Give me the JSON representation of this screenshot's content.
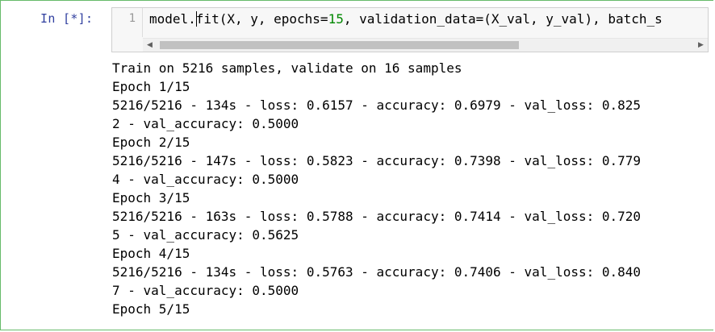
{
  "cell": {
    "prompt": "In [*]:",
    "line_number": "1",
    "code": {
      "before_cursor": "model.",
      "after_cursor_1": "fit(X, y, epochs=",
      "epochs_value": "15",
      "after_cursor_2": ", validation_data=(X_val, y_val), batch_s"
    }
  },
  "output": {
    "lines": [
      "Train on 5216 samples, validate on 16 samples",
      "Epoch 1/15",
      "5216/5216 - 134s - loss: 0.6157 - accuracy: 0.6979 - val_loss: 0.825",
      "2 - val_accuracy: 0.5000",
      "Epoch 2/15",
      "5216/5216 - 147s - loss: 0.5823 - accuracy: 0.7398 - val_loss: 0.779",
      "4 - val_accuracy: 0.5000",
      "Epoch 3/15",
      "5216/5216 - 163s - loss: 0.5788 - accuracy: 0.7414 - val_loss: 0.720",
      "5 - val_accuracy: 0.5625",
      "Epoch 4/15",
      "5216/5216 - 134s - loss: 0.5763 - accuracy: 0.7406 - val_loss: 0.840",
      "7 - val_accuracy: 0.5000",
      "Epoch 5/15"
    ]
  },
  "icons": {
    "scroll_left": "◀",
    "scroll_right": "▶"
  },
  "colors": {
    "prompt": "#303f9f",
    "number_literal": "#008800",
    "cell_border": "#66bb6a"
  }
}
